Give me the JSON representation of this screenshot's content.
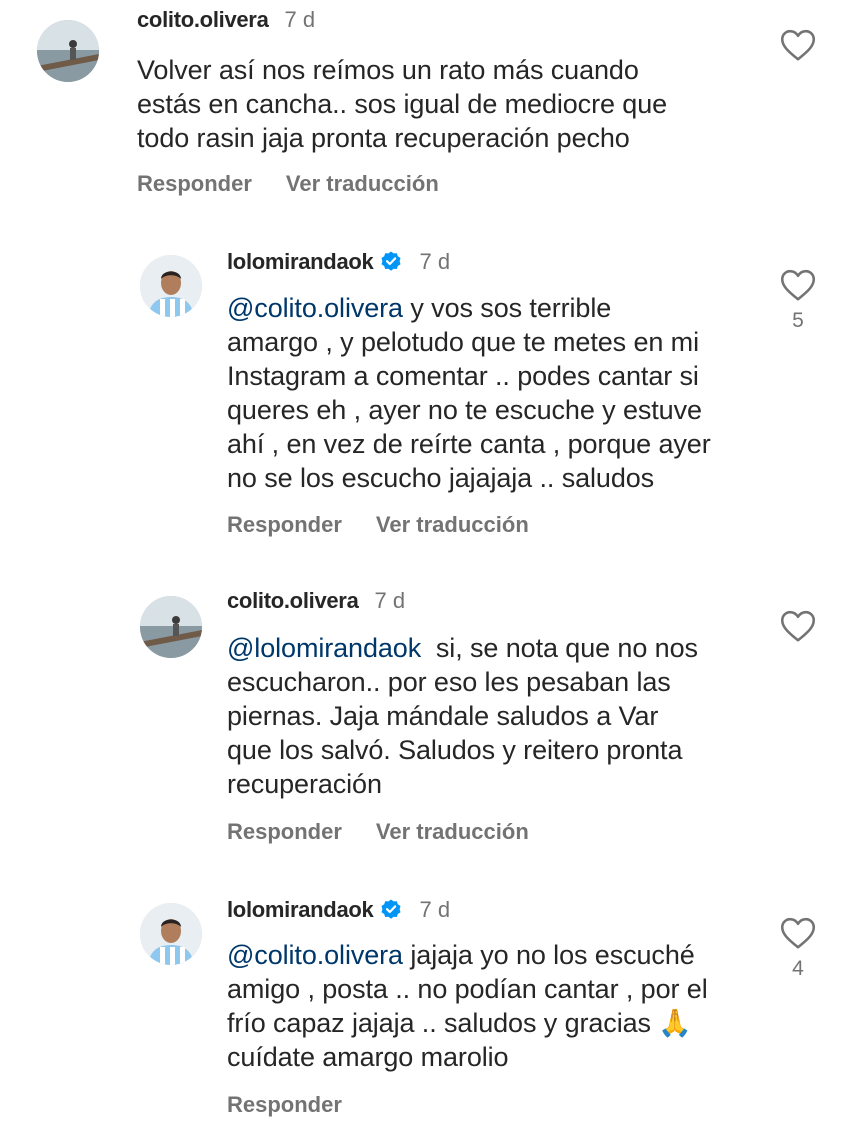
{
  "comments": [
    {
      "username": "colito.olivera",
      "time": "7 d",
      "verified": false,
      "mention": "",
      "lines": [
        "Volver así nos reímos un rato más cuando",
        "estás en cancha.. sos igual de mediocre que",
        "todo rasin jaja pronta recuperación pecho"
      ],
      "reply_label": "Responder",
      "translate_label": "Ver traducción",
      "likes": ""
    },
    {
      "username": "lolomirandaok",
      "time": "7 d",
      "verified": true,
      "mention": "@colito.olivera",
      "lines": [
        " y vos sos terrible",
        "amargo , y pelotudo que te metes en mi",
        "Instagram a comentar .. podes cantar si",
        "queres eh , ayer no te escuche y estuve",
        "ahí , en vez de reírte canta , porque ayer",
        "no se los escucho jajajaja .. saludos"
      ],
      "reply_label": "Responder",
      "translate_label": "Ver traducción",
      "likes": "5"
    },
    {
      "username": "colito.olivera",
      "time": "7 d",
      "verified": false,
      "mention": "@lolomirandaok",
      "lines": [
        "  si, se nota que no nos",
        "escucharon.. por eso les pesaban las",
        "piernas. Jaja mándale saludos a Var",
        "que los salvó. Saludos y reitero pronta",
        "recuperación"
      ],
      "reply_label": "Responder",
      "translate_label": "Ver traducción",
      "likes": ""
    },
    {
      "username": "lolomirandaok",
      "time": "7 d",
      "verified": true,
      "mention": "@colito.olivera",
      "lines": [
        " jajaja yo no los escuché",
        "amigo , posta .. no podían cantar , por el",
        "frío capaz jajaja .. saludos y gracias 🙏",
        "cuídate amargo marolio"
      ],
      "reply_label": "Responder",
      "translate_label": "",
      "likes": "4"
    }
  ],
  "icons": {
    "like": "heart-outline-icon",
    "verified": "verified-badge-icon"
  },
  "colors": {
    "mention": "#00376b",
    "verified": "#0095f6",
    "secondary_text": "#737373"
  }
}
